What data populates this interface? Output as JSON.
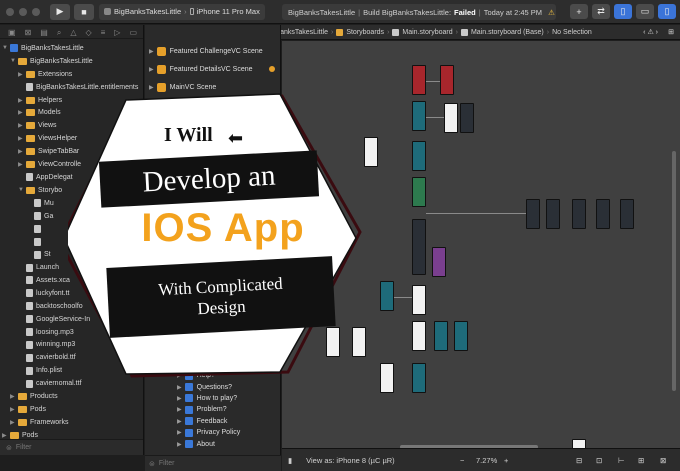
{
  "toolbar": {
    "scheme_project": "BigBanksTakesLittle",
    "scheme_device": "iPhone 11 Pro Max",
    "status_project": "BigBanksTakesLittle",
    "status_build": "Build BigBanksTakesLittle:",
    "status_result": "Failed",
    "status_time": "Today at 2:45 PM",
    "warning_count": "179",
    "error_count": "1",
    "add_label": "+",
    "swap_label": "⇄"
  },
  "breadcrumb": {
    "items": [
      "BigBanksTakesLittle",
      "BigBanksTakesLittle",
      "Storyboards",
      "Main.storyboard",
      "Main.storyboard (Base)",
      "No Selection"
    ]
  },
  "navigator": {
    "root": "BigBanksTakesLittle",
    "items": [
      {
        "label": "BigBanksTakesLittle",
        "kind": "folder",
        "indent": 1,
        "open": true
      },
      {
        "label": "Extensions",
        "kind": "folder",
        "indent": 2
      },
      {
        "label": "BigBanksTakesLittle.entitlements",
        "kind": "file",
        "indent": 2
      },
      {
        "label": "Helpers",
        "kind": "folder",
        "indent": 2
      },
      {
        "label": "Models",
        "kind": "folder",
        "indent": 2
      },
      {
        "label": "Views",
        "kind": "folder",
        "indent": 2
      },
      {
        "label": "ViewsHelper",
        "kind": "folder",
        "indent": 2
      },
      {
        "label": "SwipeTabBar",
        "kind": "folder",
        "indent": 2
      },
      {
        "label": "ViewControlle",
        "kind": "folder",
        "indent": 2
      },
      {
        "label": "AppDelegat",
        "kind": "file",
        "indent": 2
      },
      {
        "label": "Storybo",
        "kind": "folder",
        "indent": 2,
        "open": true
      },
      {
        "label": "Mu",
        "kind": "file",
        "indent": 3
      },
      {
        "label": "Ga",
        "kind": "file",
        "indent": 3
      },
      {
        "label": "",
        "kind": "file",
        "indent": 3
      },
      {
        "label": "",
        "kind": "file",
        "indent": 3
      },
      {
        "label": "St",
        "kind": "file",
        "indent": 3
      },
      {
        "label": "Launch",
        "kind": "file",
        "indent": 2
      },
      {
        "label": "Assets.xca",
        "kind": "file",
        "indent": 2
      },
      {
        "label": "luckyfont.tt",
        "kind": "file",
        "indent": 2
      },
      {
        "label": "backtoschoolfo",
        "kind": "file",
        "indent": 2
      },
      {
        "label": "GoogleService-In",
        "kind": "file",
        "indent": 2
      },
      {
        "label": "loosing.mp3",
        "kind": "file",
        "indent": 2
      },
      {
        "label": "winning.mp3",
        "kind": "file",
        "indent": 2
      },
      {
        "label": "cavierbold.ttf",
        "kind": "file",
        "indent": 2
      },
      {
        "label": "Info.plist",
        "kind": "file",
        "indent": 2
      },
      {
        "label": "caviernomal.ttf",
        "kind": "file",
        "indent": 2
      },
      {
        "label": "Products",
        "kind": "folder",
        "indent": 1
      },
      {
        "label": "Pods",
        "kind": "folder",
        "indent": 1
      },
      {
        "label": "Frameworks",
        "kind": "folder",
        "indent": 1
      },
      {
        "label": "Pods",
        "kind": "folder",
        "indent": 0
      }
    ],
    "filter_placeholder": "Filter"
  },
  "outline": {
    "scenes": [
      "Featured ChallengeVC Scene",
      "Featured DetailsVC Scene",
      "MainVC Scene"
    ],
    "bottom_items": [
      "Help?",
      "Questions?",
      "How to play?",
      "Problem?",
      "Feedback",
      "Privacy Policy",
      "About"
    ],
    "filter_placeholder": "Filter"
  },
  "bottombar": {
    "view_as": "View as: iPhone 8 (µC µR)",
    "zoom_out": "−",
    "zoom": "7.27%",
    "zoom_in": "+"
  },
  "promo": {
    "line1": "I Will",
    "line2": "Develop an",
    "line3": "IOS App",
    "line4a": "With Complicated",
    "line4b": "Design",
    "accent": "#f3a21d"
  }
}
